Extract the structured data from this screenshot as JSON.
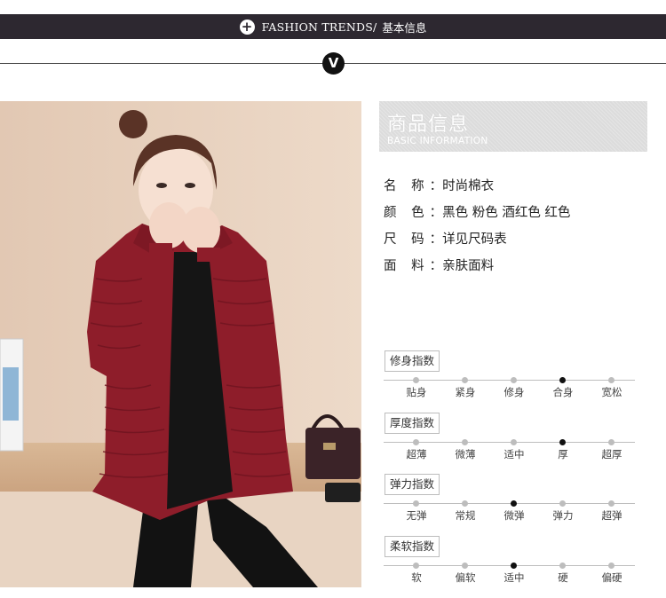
{
  "banner": {
    "title": "FASHION TRENDS/",
    "title_cn": "基本信息",
    "plus_icon": "+"
  },
  "divider": {
    "v_icon": "V"
  },
  "info": {
    "title": "商品信息",
    "subtitle": "BASIC INFORMATION",
    "rows": [
      {
        "label": "名 称",
        "value": "时尚棉衣"
      },
      {
        "label": "颜 色",
        "value": "黑色 粉色 酒红色 红色"
      },
      {
        "label": "尺 码",
        "value": "详见尺码表"
      },
      {
        "label": "面 料",
        "value": "亲肤面料"
      }
    ]
  },
  "scales": [
    {
      "label": "修身指数",
      "options": [
        "贴身",
        "紧身",
        "修身",
        "合身",
        "宽松"
      ],
      "selected": 3
    },
    {
      "label": "厚度指数",
      "options": [
        "超薄",
        "微薄",
        "适中",
        "厚",
        "超厚"
      ],
      "selected": 3
    },
    {
      "label": "弹力指数",
      "options": [
        "无弹",
        "常规",
        "微弹",
        "弹力",
        "超弹"
      ],
      "selected": 2
    },
    {
      "label": "柔软指数",
      "options": [
        "软",
        "偏软",
        "适中",
        "硬",
        "偏硬"
      ],
      "selected": 2
    }
  ],
  "colors": {
    "banner": "#2d2830",
    "jacket": "#8e1d2a",
    "track": "#bdbdbd",
    "active_dot": "#111111"
  }
}
